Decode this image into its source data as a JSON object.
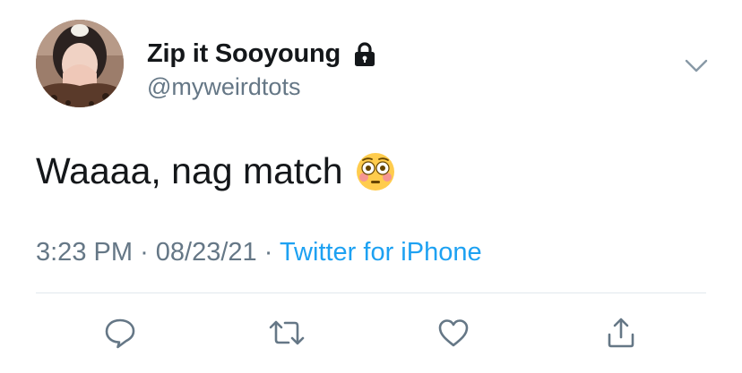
{
  "tweet": {
    "display_name": "Zip it Sooyoung",
    "handle": "@myweirdtots",
    "protected_icon": "lock-icon",
    "menu_icon": "chevron-down-icon",
    "text": "Waaaa, nag match",
    "emoji": "flushed-face-emoji",
    "time": "3:23 PM",
    "separator": "·",
    "date": "08/23/21",
    "source": "Twitter for iPhone"
  },
  "actions": [
    {
      "icon": "reply-icon"
    },
    {
      "icon": "retweet-icon"
    },
    {
      "icon": "like-icon"
    },
    {
      "icon": "share-icon"
    }
  ],
  "colors": {
    "text": "#14171a",
    "secondary": "#657786",
    "link": "#1da1f2",
    "divider": "#e1e8ed"
  }
}
